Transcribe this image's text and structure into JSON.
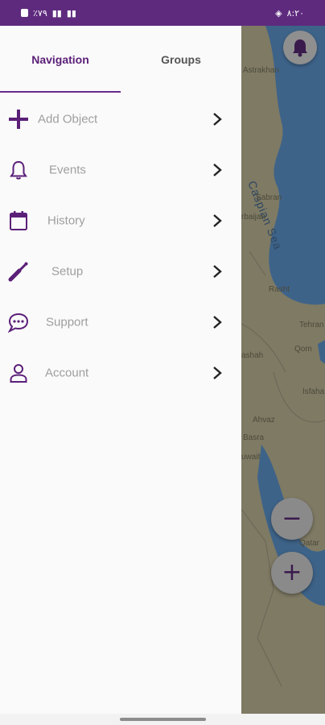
{
  "status_bar": {
    "left_text": "٪۷۹",
    "right_text": "۸:۲۰"
  },
  "drawer": {
    "tabs": [
      {
        "label": "Navigation",
        "active": true
      },
      {
        "label": "Groups",
        "active": false
      }
    ],
    "menu_items": [
      {
        "label": "Add Object",
        "icon": "plus-icon"
      },
      {
        "label": "Events",
        "icon": "bell-icon"
      },
      {
        "label": "History",
        "icon": "calendar-icon"
      },
      {
        "label": "Setup",
        "icon": "wrench-icon"
      },
      {
        "label": "Support",
        "icon": "chat-icon"
      },
      {
        "label": "Account",
        "icon": "person-icon"
      }
    ]
  },
  "map": {
    "labels": [
      {
        "text": "Astrakhan"
      },
      {
        "text": "Şabran"
      },
      {
        "text": "rbaijan"
      },
      {
        "text": "Rasht"
      },
      {
        "text": "Tehran"
      },
      {
        "text": "Qom"
      },
      {
        "text": "ashah"
      },
      {
        "text": "Isfaha"
      },
      {
        "text": "Ahvaz"
      },
      {
        "text": "Basra"
      },
      {
        "text": "uwait"
      },
      {
        "text": "Qatar"
      }
    ],
    "sea_label": "Caspian Sea",
    "zoom_out_label": "−",
    "zoom_in_label": "+"
  },
  "colors": {
    "brand": "#5e2a7e",
    "accent_icon": "#5b1f78",
    "menu_text": "#9e9e9e"
  }
}
